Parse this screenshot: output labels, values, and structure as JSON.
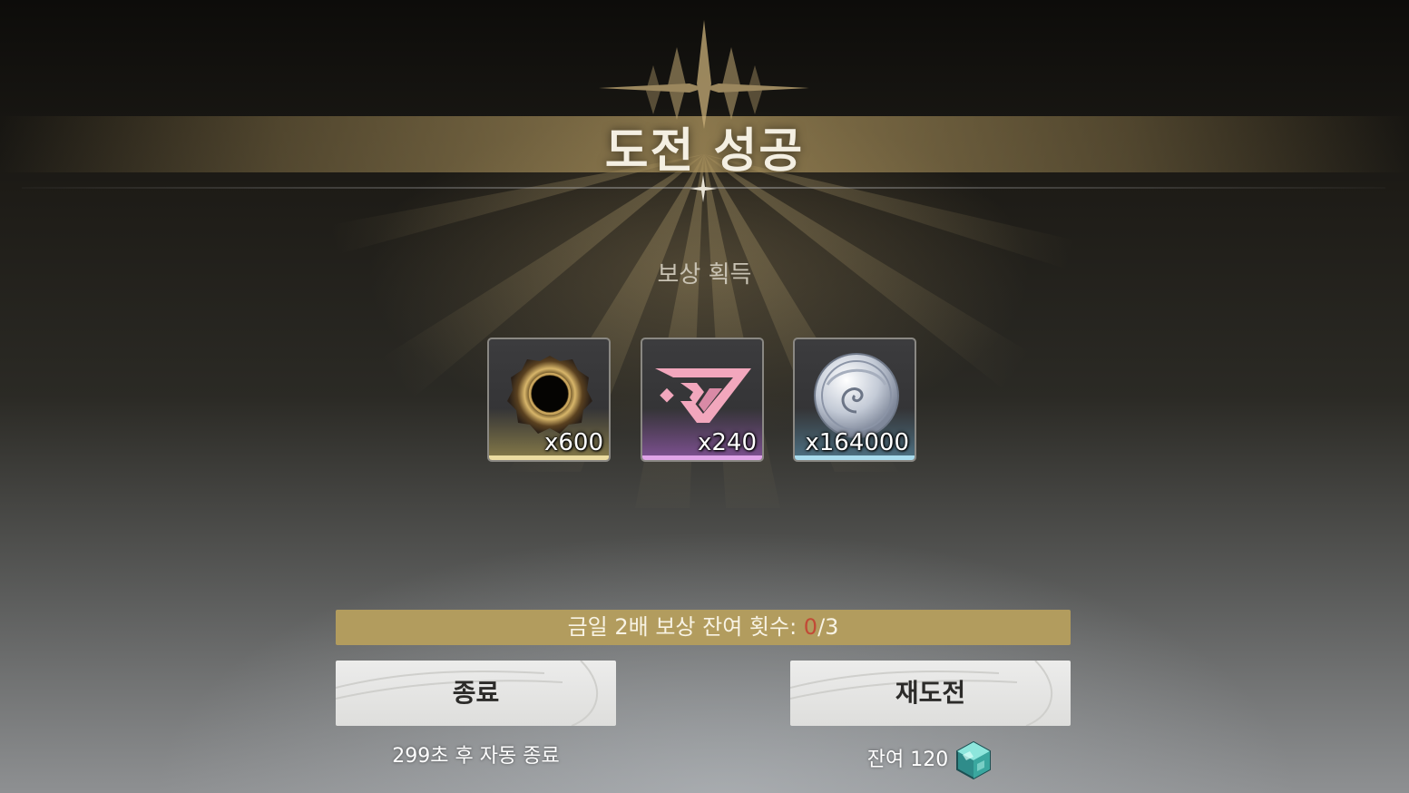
{
  "result": {
    "title": "도전 성공"
  },
  "rewards": {
    "label": "보상 획득",
    "items": [
      {
        "icon": "dark-ring-icon",
        "quantity": "x600",
        "rarity_color": "#ecdca1"
      },
      {
        "icon": "pink-emblem-icon",
        "quantity": "x240",
        "rarity_color": "#e0a4e8"
      },
      {
        "icon": "silver-coin-icon",
        "quantity": "x164000",
        "rarity_color": "#a9dcee"
      }
    ]
  },
  "bonus": {
    "label": "금일 2배 보상 잔여 횟수: ",
    "current": "0",
    "total": "/3"
  },
  "buttons": {
    "exit_label": "종료",
    "exit_subtext": "299초 후 자동 종료",
    "retry_label": "재도전",
    "retry_subtext": "잔여 120",
    "retry_cost_icon": "teal-cube-icon"
  },
  "colors": {
    "bonus_bar": "#b29c5e",
    "bonus_current": "#c24a36",
    "title_band": "#af965f"
  }
}
